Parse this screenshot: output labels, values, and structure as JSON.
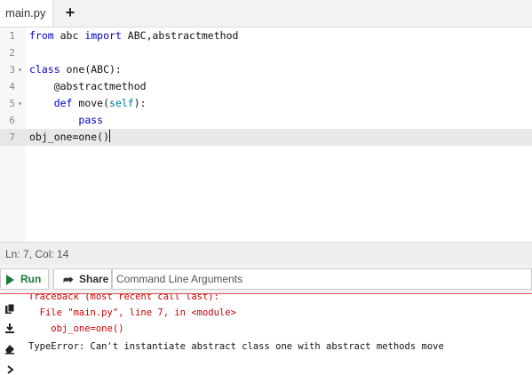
{
  "tabs": {
    "file_name": "main.py",
    "add_label": "+"
  },
  "editor": {
    "line_numbers": [
      "1",
      "2",
      "3",
      "4",
      "5",
      "6",
      "7"
    ],
    "fold_markers": {
      "3": "▾",
      "5": "▾"
    },
    "code": {
      "l1": {
        "t1": "from",
        "t2": " abc ",
        "t3": "import",
        "t4": " ABC,abstractmethod"
      },
      "l3": {
        "t1": "class",
        "t2": " one(ABC):"
      },
      "l4": {
        "t1": "    @abstractmethod"
      },
      "l5": {
        "t1": "    ",
        "t2": "def",
        "t3": " move(",
        "t4": "self",
        "t5": "):"
      },
      "l6": {
        "t1": "        ",
        "t2": "pass"
      },
      "l7": {
        "t1": "obj_one=one()"
      }
    }
  },
  "status": {
    "position": "Ln: 7,  Col: 14"
  },
  "toolbar": {
    "run_label": "Run",
    "share_label": "Share",
    "args_placeholder": "Command Line Arguments"
  },
  "output": {
    "lines": [
      "Traceback (most recent call last):",
      "  File \"main.py\", line 7, in <module>",
      "    obj_one=one()",
      "TypeError: Can't instantiate abstract class one with abstract methods move"
    ]
  },
  "colors": {
    "keyword": "#0000cc",
    "error": "#cc0000",
    "run": "#1a7a3a"
  }
}
